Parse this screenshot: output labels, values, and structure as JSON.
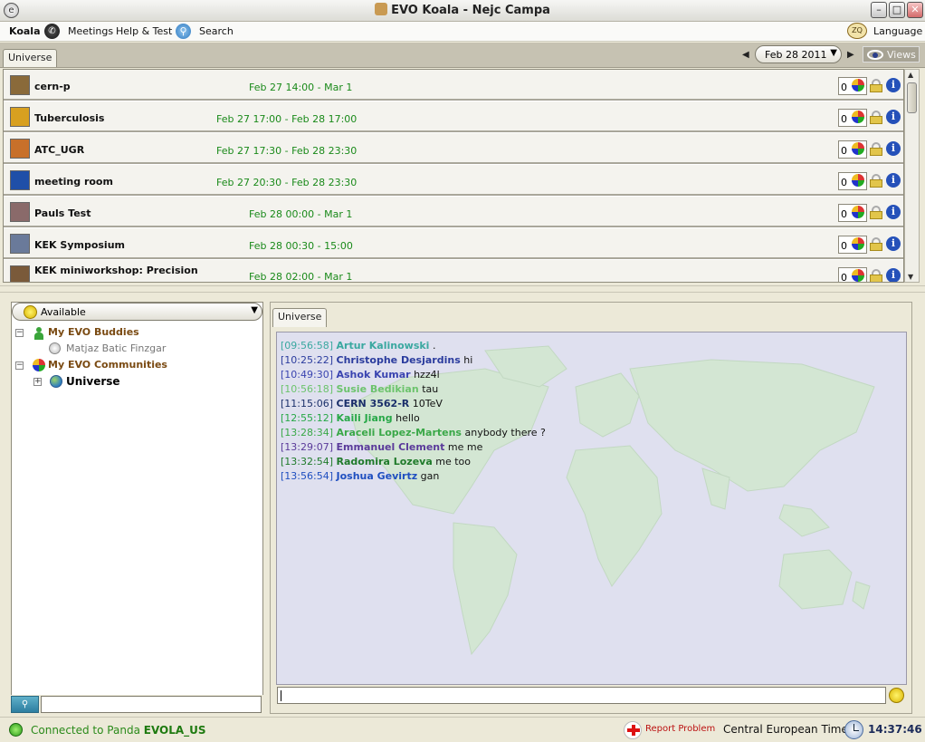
{
  "window": {
    "title": "EVO Koala  - Nejc Campa",
    "app_icon": "e-logo-icon"
  },
  "menubar": {
    "koala": "Koala",
    "meetings": "Meetings",
    "help_test": "Help & Test",
    "search": "Search",
    "language": "Language",
    "language_icon_text": "ZQ"
  },
  "toprow": {
    "tab": "Universe",
    "date": "Feb 28 2011",
    "views": "Views"
  },
  "meetings": [
    {
      "name": "cern-p",
      "time": "Feb 27 14:00 - Mar 1",
      "participants": "0",
      "thumb_color": "#8a6a3a"
    },
    {
      "name": "Tuberculosis",
      "time": "Feb 27 17:00 - Feb 28 17:00",
      "participants": "0",
      "thumb_color": "#d8a020"
    },
    {
      "name": "ATC_UGR",
      "time": "Feb 27 17:30 - Feb 28 23:30",
      "participants": "0",
      "thumb_color": "#c8702a"
    },
    {
      "name": "meeting room",
      "time": "Feb 27 20:30 - Feb 28 23:30",
      "participants": "0",
      "thumb_color": "#1f4fa8"
    },
    {
      "name": "Pauls Test",
      "time": "Feb 28 00:00 - Mar 1",
      "participants": "0",
      "thumb_color": "#8a6a6a"
    },
    {
      "name": "KEK Symposium",
      "time": "Feb 28 00:30 - 15:00",
      "participants": "0",
      "thumb_color": "#6a7a9a"
    },
    {
      "name": "KEK miniworkshop: Precision",
      "time": "Feb 28 02:00 - Mar 1",
      "participants": "0",
      "thumb_color": "#7a5a3a"
    }
  ],
  "left": {
    "status": "Available",
    "buddies_group": "My EVO Buddies",
    "buddy_1": "Matjaz Batic Finzgar",
    "communities_group": "My EVO Communities",
    "community_1": "Universe"
  },
  "chat": {
    "tab": "Universe",
    "lines": [
      {
        "ts": "[09:56:58]",
        "name": "Artur Kalinowski",
        "msg": ".",
        "color": "#3aa8a0"
      },
      {
        "ts": "[10:25:22]",
        "name": "Christophe Desjardins",
        "msg": "hi",
        "color": "#2b3c9e"
      },
      {
        "ts": "[10:49:30]",
        "name": "Ashok Kumar",
        "msg": "hzz4l",
        "color": "#3a44b0"
      },
      {
        "ts": "[10:56:18]",
        "name": "Susie Bedikian",
        "msg": "tau",
        "color": "#6cc36c"
      },
      {
        "ts": "[11:15:06]",
        "name": "CERN 3562-R",
        "msg": "10TeV",
        "color": "#1a2f6a"
      },
      {
        "ts": "[12:55:12]",
        "name": "Kaili Jiang",
        "msg": "hello",
        "color": "#28a848"
      },
      {
        "ts": "[13:28:34]",
        "name": "Araceli Lopez-Martens",
        "msg": "anybody there ?",
        "color": "#3aa848"
      },
      {
        "ts": "[13:29:07]",
        "name": "Emmanuel Clement",
        "msg": "me me",
        "color": "#5a3a9a"
      },
      {
        "ts": "[13:32:54]",
        "name": "Radomira Lozeva",
        "msg": "me too",
        "color": "#1f7a2a"
      },
      {
        "ts": "[13:56:54]",
        "name": "Joshua Gevirtz",
        "msg": "gan",
        "color": "#1f4fc0"
      }
    ]
  },
  "statusbar": {
    "connected_prefix": "Connected to Panda",
    "server": "EVOLA_US",
    "report": "Report Problem",
    "timezone": "Central European Time",
    "time": "14:37:46"
  },
  "colors": {
    "meeting_time": "#1a8a1a",
    "info": "#2551b9",
    "group_label": "#7a4a12",
    "chat_bg": "#dfe0ef",
    "map_land": "#d3e6d3"
  }
}
